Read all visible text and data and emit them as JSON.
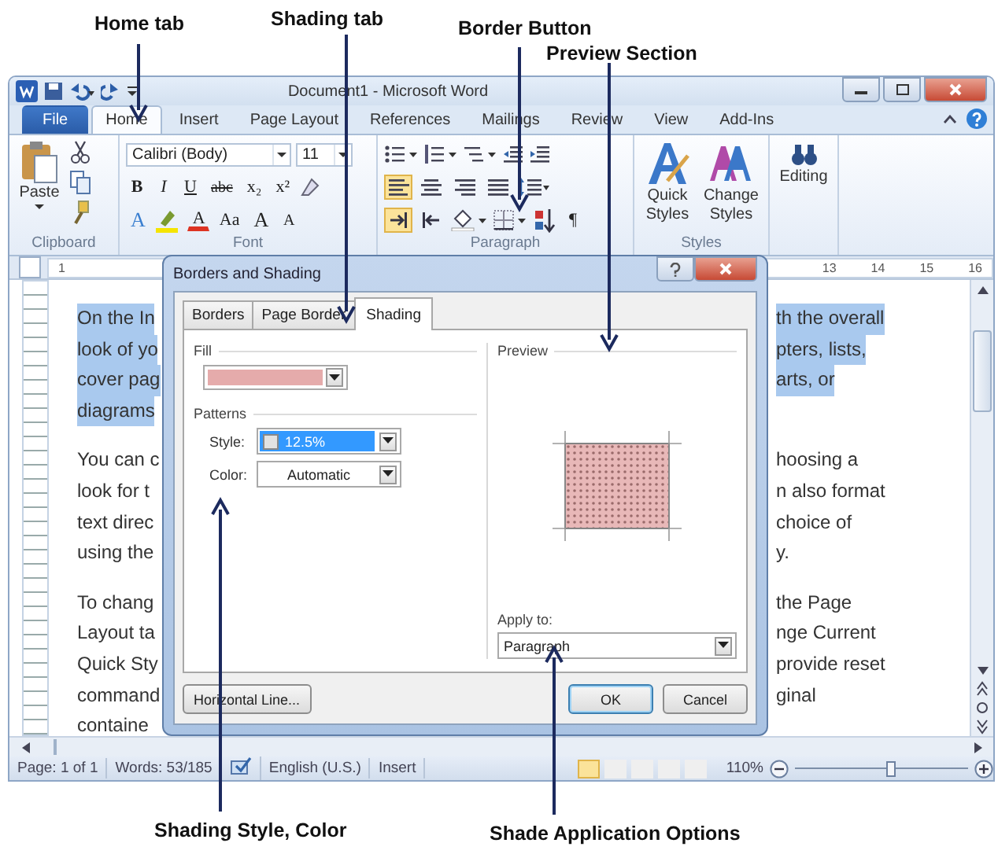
{
  "annotations": [
    {
      "label": "Home tab"
    },
    {
      "label": "Shading tab"
    },
    {
      "label": "Border Button"
    },
    {
      "label": "Preview Section"
    },
    {
      "label": "Shading Style, Color"
    },
    {
      "label": "Shade Application Options"
    }
  ],
  "window": {
    "title": "Document1 - Microsoft Word"
  },
  "tabs": [
    {
      "label": "File",
      "kind": "file",
      "selected": false
    },
    {
      "label": "Home",
      "kind": "tab",
      "selected": true
    },
    {
      "label": "Insert",
      "kind": "tab",
      "selected": false
    },
    {
      "label": "Page Layout",
      "kind": "tab",
      "selected": false
    },
    {
      "label": "References",
      "kind": "tab",
      "selected": false
    },
    {
      "label": "Mailings",
      "kind": "tab",
      "selected": false
    },
    {
      "label": "Review",
      "kind": "tab",
      "selected": false
    },
    {
      "label": "View",
      "kind": "tab",
      "selected": false
    },
    {
      "label": "Add-Ins",
      "kind": "tab",
      "selected": false
    }
  ],
  "ribbon": {
    "clipboard": {
      "label": "Clipboard",
      "paste": "Paste"
    },
    "font": {
      "label": "Font",
      "font_name": "Calibri (Body)",
      "font_size": "11",
      "row1": [
        {
          "kind": "bold",
          "text": "B"
        },
        {
          "kind": "italic",
          "text": "I"
        },
        {
          "kind": "underline",
          "text": "U"
        },
        {
          "kind": "strike",
          "text": "abc"
        },
        {
          "kind": "plain",
          "text": "x₂"
        },
        {
          "kind": "plain",
          "text": "x²"
        }
      ],
      "row2": [
        {
          "kind": "effects",
          "text": "A"
        },
        {
          "kind": "highlight"
        },
        {
          "kind": "color",
          "text": "A"
        },
        {
          "kind": "plain",
          "text": "Aa"
        },
        {
          "kind": "grow",
          "text": "A"
        },
        {
          "kind": "shrink",
          "text": "A"
        }
      ]
    },
    "paragraph": {
      "label": "Paragraph",
      "align": [
        {
          "selected": true
        },
        {
          "selected": false
        },
        {
          "selected": false
        },
        {
          "selected": false
        }
      ],
      "direction": [
        {
          "selected": true
        },
        {
          "selected": false
        }
      ],
      "pilcrow": "¶"
    },
    "styles": {
      "label": "Styles",
      "quick": "Quick Styles",
      "change": "Change Styles"
    },
    "editing": {
      "label": "Editing"
    }
  },
  "ruler": {
    "left_numbers": [
      "1"
    ],
    "right_numbers": [
      "13",
      "14",
      "15",
      "16"
    ]
  },
  "document": {
    "paragraphs": [
      {
        "highlighted": true,
        "lines": [
          {
            "left": "On the In",
            "right": "th the overall"
          },
          {
            "left": "look of yo",
            "right": "pters, lists,"
          },
          {
            "left": "cover pag",
            "right": "arts, or"
          },
          {
            "left": "diagrams"
          }
        ]
      },
      {
        "highlighted": false,
        "lines": [
          {
            "left": "You can c",
            "right": "hoosing a"
          },
          {
            "left": "look for t",
            "right": "n also format"
          },
          {
            "left": "text direc",
            "right": "choice of"
          },
          {
            "left": "using the",
            "right": "y."
          }
        ]
      },
      {
        "highlighted": false,
        "lines": [
          {
            "left": "To chang",
            "right": "the Page"
          },
          {
            "left": "Layout ta",
            "right": "nge Current"
          },
          {
            "left": "Quick Sty",
            "right": "provide reset"
          },
          {
            "left": "command",
            "right": "ginal"
          },
          {
            "left": "containe"
          }
        ]
      }
    ]
  },
  "dialog": {
    "title": "Borders and Shading",
    "tabs": [
      {
        "label": "Borders",
        "selected": false
      },
      {
        "label": "Page Border",
        "selected": false
      },
      {
        "label": "Shading",
        "selected": true
      }
    ],
    "fill_label": "Fill",
    "patterns_label": "Patterns",
    "style": {
      "label": "Style:",
      "value": "12.5%",
      "focused": true
    },
    "color": {
      "label": "Color:",
      "value": "Automatic",
      "focused": false
    },
    "preview_label": "Preview",
    "apply": {
      "label": "Apply to:",
      "value": "Paragraph"
    },
    "buttons": [
      {
        "label": "Horizontal Line...",
        "kind": "normal"
      },
      {
        "label": "OK",
        "kind": "default"
      },
      {
        "label": "Cancel",
        "kind": "normal"
      }
    ]
  },
  "status_bar": {
    "page": "Page: 1 of 1",
    "words": "Words: 53/185",
    "language": "English (U.S.)",
    "mode": "Insert",
    "views": [
      {
        "selected": true
      },
      {
        "selected": false
      },
      {
        "selected": false
      },
      {
        "selected": false
      },
      {
        "selected": false
      }
    ],
    "zoom": "110%",
    "zoom_slider": {
      "level": 0.55
    }
  }
}
